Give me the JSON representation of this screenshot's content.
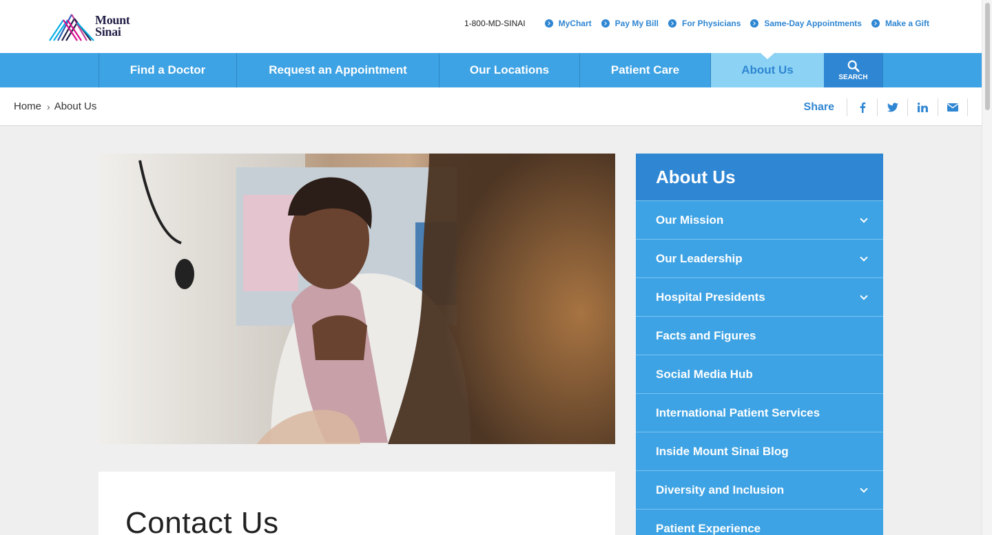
{
  "header": {
    "logo_text_line1": "Mount",
    "logo_text_line2": "Sinai",
    "phone": "1-800-MD-SINAI",
    "utility_links": [
      "MyChart",
      "Pay My Bill",
      "For Physicians",
      "Same-Day Appointments",
      "Make a Gift"
    ]
  },
  "nav": {
    "items": [
      "Find a Doctor",
      "Request an Appointment",
      "Our Locations",
      "Patient Care",
      "About Us"
    ],
    "active": "About Us",
    "search_label": "SEARCH"
  },
  "breadcrumb": {
    "home": "Home",
    "current": "About Us",
    "separator": "›"
  },
  "share": {
    "label": "Share",
    "icons": [
      "facebook-icon",
      "twitter-icon",
      "linkedin-icon",
      "email-icon"
    ]
  },
  "hero": {
    "alt_icon": "photo-icon"
  },
  "card": {
    "heading": "Contact Us"
  },
  "sidebar": {
    "title": "About Us",
    "items": [
      {
        "label": "Our Mission",
        "expandable": true
      },
      {
        "label": "Our Leadership",
        "expandable": true
      },
      {
        "label": "Hospital Presidents",
        "expandable": true
      },
      {
        "label": "Facts and Figures",
        "expandable": false
      },
      {
        "label": "Social Media Hub",
        "expandable": false
      },
      {
        "label": "International Patient Services",
        "expandable": false
      },
      {
        "label": "Inside Mount Sinai Blog",
        "expandable": false
      },
      {
        "label": "Diversity and Inclusion",
        "expandable": true
      },
      {
        "label": "Patient Experience",
        "expandable": false
      }
    ]
  },
  "colors": {
    "brand_blue": "#3ea3e4",
    "dark_blue": "#2f86d2",
    "active_tab": "#8bd2f4",
    "navy": "#221f47",
    "magenta": "#d80b8c"
  }
}
